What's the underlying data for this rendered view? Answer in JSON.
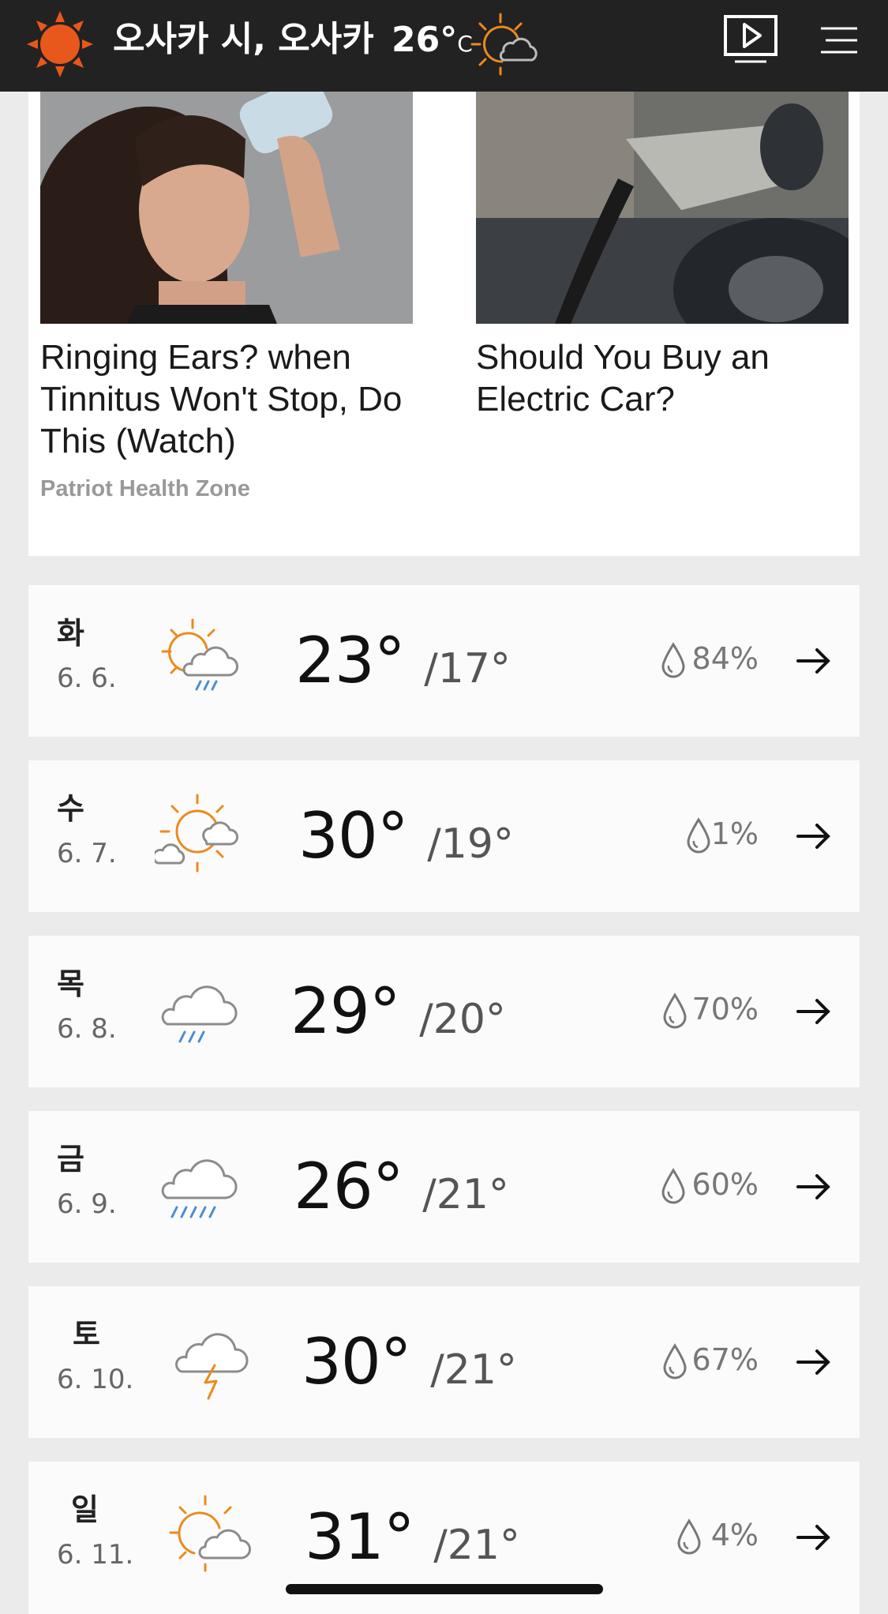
{
  "header": {
    "title": "오사카 시, 오사카",
    "temperature": "26°",
    "unit": "C",
    "current_condition_icon": "sun-cloud-icon",
    "brand_color": "#e8581c",
    "background": "#222222"
  },
  "ads": [
    {
      "title": "Ringing Ears? when Tinnitus Won't Stop, Do This (Watch)",
      "source": "Patriot Health Zone",
      "image": "woman-with-water-bottle"
    },
    {
      "title": "Should You Buy an Electric Car?",
      "source": "",
      "image": "ev-charger-plug"
    }
  ],
  "forecast": [
    {
      "day": "화",
      "date": "6. 6.",
      "icon": "partly-sunny-rain-icon",
      "high": "23°",
      "low": "/17°",
      "precip": "84%"
    },
    {
      "day": "수",
      "date": "6. 7.",
      "icon": "sun-clouds-icon",
      "high": "30°",
      "low": "/19°",
      "precip": "1%"
    },
    {
      "day": "목",
      "date": "6. 8.",
      "icon": "cloud-rain-icon",
      "high": "29°",
      "low": "/20°",
      "precip": "70%"
    },
    {
      "day": "금",
      "date": "6. 9.",
      "icon": "cloud-heavy-rain-icon",
      "high": "26°",
      "low": "/21°",
      "precip": "60%"
    },
    {
      "day": "토",
      "date": "6. 10.",
      "icon": "cloud-lightning-icon",
      "high": "30°",
      "low": "/21°",
      "precip": "67%"
    },
    {
      "day": "일",
      "date": "6. 11.",
      "icon": "sun-cloud-icon",
      "high": "31°",
      "low": "/21°",
      "precip": "4%"
    }
  ],
  "colors": {
    "sun": "#ec8a1e",
    "rain": "#4a8ed1",
    "cloud_stroke": "#8c8c8c",
    "page_bg": "#ebebeb"
  }
}
